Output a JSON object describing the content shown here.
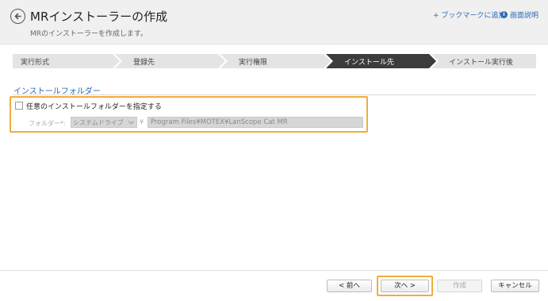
{
  "header": {
    "title": "MRインストーラーの作成",
    "subtitle": "MRのインストーラーを作成します。",
    "bookmark_label": "+ ブックマークに追加",
    "help_label": "画面説明",
    "back_icon": "arrow-left-circle-icon",
    "help_icon": "info-circle-icon"
  },
  "steps": [
    {
      "label": "実行形式",
      "active": false
    },
    {
      "label": "登録先",
      "active": false
    },
    {
      "label": "実行権限",
      "active": false
    },
    {
      "label": "インストール先",
      "active": true
    },
    {
      "label": "インストール実行後",
      "active": false
    }
  ],
  "section": {
    "title": "インストールフォルダー",
    "checkbox_label": "任意のインストールフォルダーを指定する",
    "checkbox_checked": false,
    "folder_label": "フォルダー*:",
    "drive_value": "システムドライブ",
    "separator": "¥",
    "path_value": "Program Files¥MOTEX¥LanScope Cat MR"
  },
  "footer": {
    "prev_label": "< 前へ",
    "next_label": "次へ >",
    "create_label": "作成",
    "cancel_label": "キャンセル"
  },
  "colors": {
    "accent": "#2a6cb5",
    "active_step": "#3c3c3c",
    "inactive_step": "#e4e4e4",
    "highlight": "#f0ad3c"
  }
}
